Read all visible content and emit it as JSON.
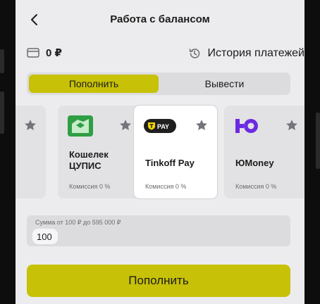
{
  "header": {
    "title": "Работа с балансом",
    "back_icon": "chevron-left-icon"
  },
  "balance": {
    "icon": "wallet-icon",
    "value": "0 ₽"
  },
  "history": {
    "icon": "history-icon",
    "label": "История платежей"
  },
  "tabs": [
    {
      "label": "Пополнить",
      "active": true
    },
    {
      "label": "Вывести",
      "active": false
    }
  ],
  "methods": [
    {
      "name": "",
      "commission": "",
      "icon": "star-icon",
      "selected": false
    },
    {
      "name": "Кошелек ЦУПИС",
      "commission": "Комиссия 0 %",
      "logo": "cupis-wallet-logo",
      "selected": false
    },
    {
      "name": "Tinkoff Pay",
      "commission": "Комиссия 0 %",
      "logo": "tinkoff-pay-logo",
      "logo_text": "PAY",
      "selected": true
    },
    {
      "name": "ЮMoney",
      "commission": "Комиссия 0 %",
      "logo": "yoomoney-logo",
      "selected": false
    }
  ],
  "amount": {
    "hint": "Сумма от 100 ₽ до 595 000 ₽",
    "value": "100"
  },
  "submit_label": "Пополнить",
  "colors": {
    "accent": "#c7c107",
    "background": "#ececee",
    "card": "#e2e2e4",
    "yoomoney": "#6c2be0"
  }
}
